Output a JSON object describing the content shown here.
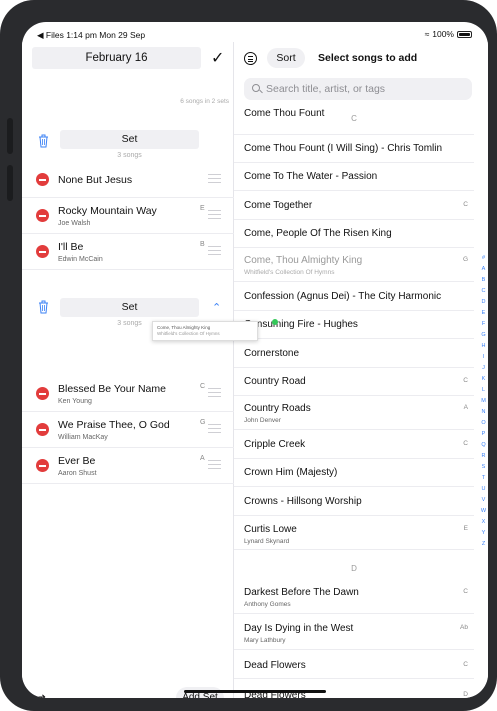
{
  "status": {
    "left": "◀ Files  1:14 pm  Mon 29 Sep",
    "battery": "100%"
  },
  "left": {
    "date": "February 16",
    "set_count": "6 songs in 2 sets",
    "sets": [
      {
        "label": "Set",
        "sub": "3 songs"
      },
      {
        "label": "Set",
        "sub": "3 songs"
      }
    ],
    "songs": [
      {
        "title": "None But Jesus",
        "artist": "",
        "key": ""
      },
      {
        "title": "Rocky Mountain Way",
        "artist": "Joe Walsh",
        "key": "E"
      },
      {
        "title": "I'll Be",
        "artist": "Edwin McCain",
        "key": "B"
      },
      {
        "title": "Blessed Be Your Name",
        "artist": "Ken Young",
        "key": "C"
      },
      {
        "title": "We Praise Thee, O God",
        "artist": "William MacKay",
        "key": "G"
      },
      {
        "title": "Ever Be",
        "artist": "Aaron Shust",
        "key": "A"
      }
    ],
    "drag_title": "Come, Thou Almighty King",
    "drag_sub": "Whitfield's Collection Of Hymns",
    "add_set": "Add Set"
  },
  "right": {
    "sort": "Sort",
    "title": "Select songs to add",
    "search_placeholder": "Search title, artist, or tags",
    "header_c": "C",
    "header_d": "D",
    "songs": [
      {
        "title": "Come Thou Fount",
        "artist": "",
        "key": ""
      },
      {
        "title": "Come Thou Fount (I Will Sing) - Chris Tomlin",
        "artist": "",
        "key": ""
      },
      {
        "title": "Come To The Water - Passion",
        "artist": "",
        "key": ""
      },
      {
        "title": "Come Together",
        "artist": "",
        "key": "C"
      },
      {
        "title": "Come, People Of The Risen King",
        "artist": "",
        "key": ""
      },
      {
        "title": "Come, Thou Almighty King",
        "artist": "Whitfield's Collection Of Hymns",
        "key": "G"
      },
      {
        "title": "Confession (Agnus Dei) - The City Harmonic",
        "artist": "",
        "key": ""
      },
      {
        "title": "Consuming Fire - Hughes",
        "artist": "",
        "key": ""
      },
      {
        "title": "Cornerstone",
        "artist": "",
        "key": ""
      },
      {
        "title": "Country Road",
        "artist": "",
        "key": "C"
      },
      {
        "title": "Country Roads",
        "artist": "John Denver",
        "key": "A"
      },
      {
        "title": "Cripple Creek",
        "artist": "",
        "key": "C"
      },
      {
        "title": "Crown Him (Majesty)",
        "artist": "",
        "key": ""
      },
      {
        "title": "Crowns - Hillsong Worship",
        "artist": "",
        "key": ""
      },
      {
        "title": "Curtis Lowe",
        "artist": "Lynard Skynard",
        "key": "E"
      },
      {
        "title": "Darkest Before The Dawn",
        "artist": "Anthony Gomes",
        "key": "C"
      },
      {
        "title": "Day Is Dying in the West",
        "artist": "Mary Lathbury",
        "key": "Ab"
      },
      {
        "title": "Dead Flowers",
        "artist": "",
        "key": "C"
      },
      {
        "title": "Dead Flowers",
        "artist": "",
        "key": "D"
      }
    ],
    "index": [
      "#",
      "A",
      "B",
      "C",
      "D",
      "E",
      "F",
      "G",
      "H",
      "I",
      "J",
      "K",
      "L",
      "M",
      "N",
      "O",
      "P",
      "Q",
      "R",
      "S",
      "T",
      "U",
      "V",
      "W",
      "X",
      "Y",
      "Z"
    ]
  }
}
